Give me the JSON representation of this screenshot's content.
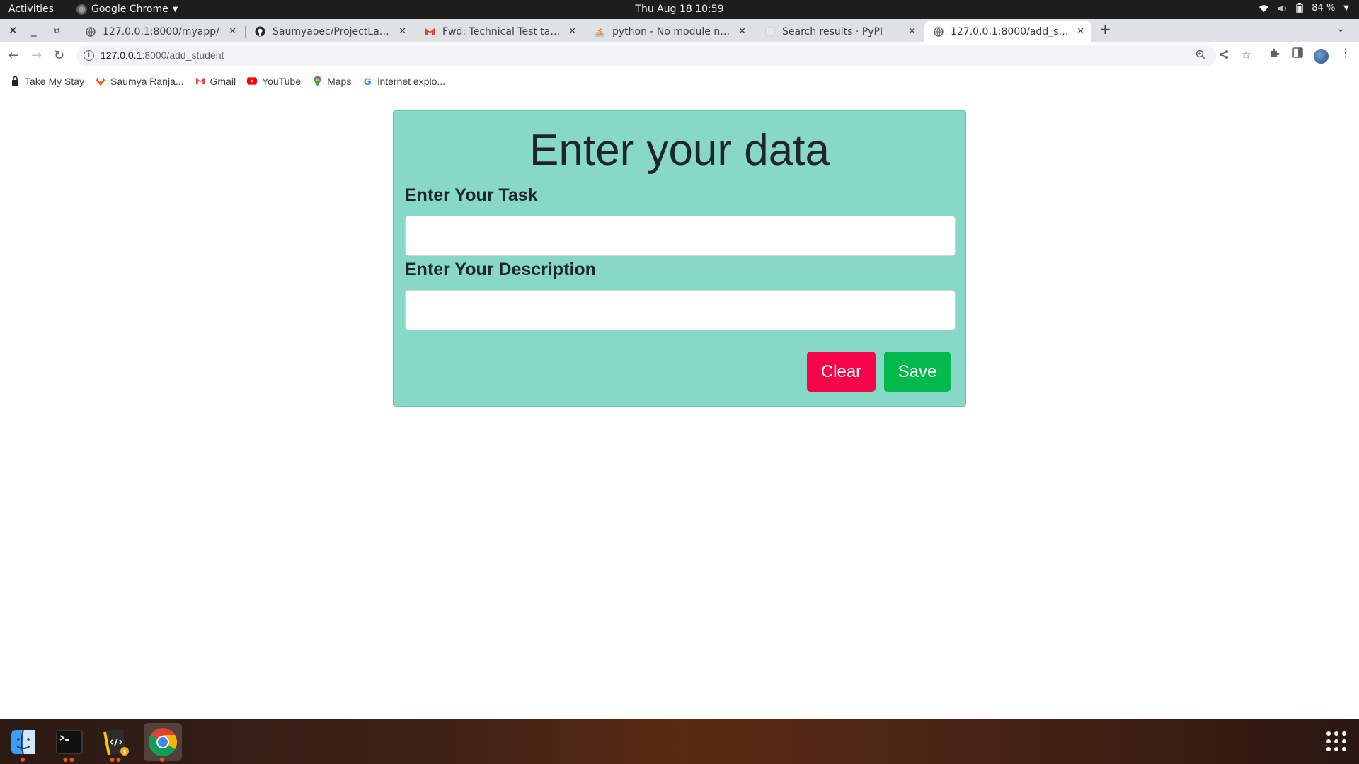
{
  "topbar": {
    "activities": "Activities",
    "app_name": "Google Chrome",
    "clock": "Thu Aug 18  10:59",
    "battery": "84 %"
  },
  "tabs": [
    {
      "title": "127.0.0.1:8000/myapp/",
      "icon": "globe-icon"
    },
    {
      "title": "Saumyaoec/ProjectLayout",
      "icon": "github-icon"
    },
    {
      "title": "Fwd: Technical Test task -",
      "icon": "gmail-icon"
    },
    {
      "title": "python - No module name",
      "icon": "stackoverflow-icon"
    },
    {
      "title": "Search results · PyPI",
      "icon": "pypi-icon"
    },
    {
      "title": "127.0.0.1:8000/add_student",
      "icon": "globe-icon"
    }
  ],
  "address": {
    "host": "127.0.0.1",
    "path": ":8000/add_student"
  },
  "bookmarks": [
    {
      "label": "Take My Stay",
      "icon": "bookmark-favicon-icon"
    },
    {
      "label": "Saumya Ranja...",
      "icon": "gitlab-icon"
    },
    {
      "label": "Gmail",
      "icon": "gmail-icon"
    },
    {
      "label": "YouTube",
      "icon": "youtube-icon"
    },
    {
      "label": "Maps",
      "icon": "maps-pin-icon"
    },
    {
      "label": "internet explo...",
      "icon": "google-icon"
    }
  ],
  "form": {
    "heading": "Enter your data",
    "task_label": "Enter Your Task",
    "task_value": "",
    "description_label": "Enter Your Description",
    "description_value": "",
    "clear_label": "Clear",
    "save_label": "Save"
  },
  "colors": {
    "card_bg": "#88d8c8",
    "clear_btn": "#f50449",
    "save_btn": "#00b84c"
  },
  "dock": [
    {
      "name": "files-app",
      "icon": "finder-icon"
    },
    {
      "name": "terminal-app",
      "icon": "terminal-icon"
    },
    {
      "name": "code-editor-app",
      "icon": "code-editor-icon"
    },
    {
      "name": "chrome-app",
      "icon": "chrome-icon"
    }
  ]
}
